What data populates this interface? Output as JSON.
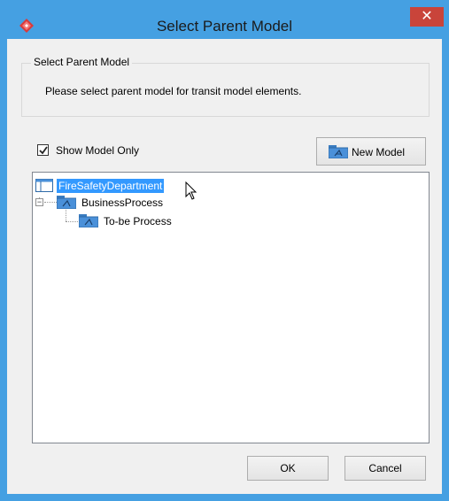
{
  "window": {
    "title": "Select Parent Model",
    "close_glyph": "✕",
    "app_icon": "visual-paradigm-icon"
  },
  "group": {
    "legend": "Select Parent Model",
    "message": "Please select parent model for transit model elements."
  },
  "options": {
    "show_model_only_label": "Show Model Only",
    "show_model_only_checked": true
  },
  "toolbar": {
    "new_model_label": "New Model",
    "new_model_icon": "package-icon"
  },
  "tree": {
    "items": [
      {
        "label": "FireSafetyDepartment",
        "icon": "project-icon",
        "selected": true
      },
      {
        "label": "BusinessProcess",
        "icon": "model-icon",
        "expanded": true
      },
      {
        "label": "To-be Process",
        "icon": "model-icon"
      }
    ]
  },
  "buttons": {
    "ok_label": "OK",
    "cancel_label": "Cancel"
  },
  "colors": {
    "title_bar": "#45a0e2",
    "selection": "#3399ff",
    "close_button": "#c9443a"
  }
}
